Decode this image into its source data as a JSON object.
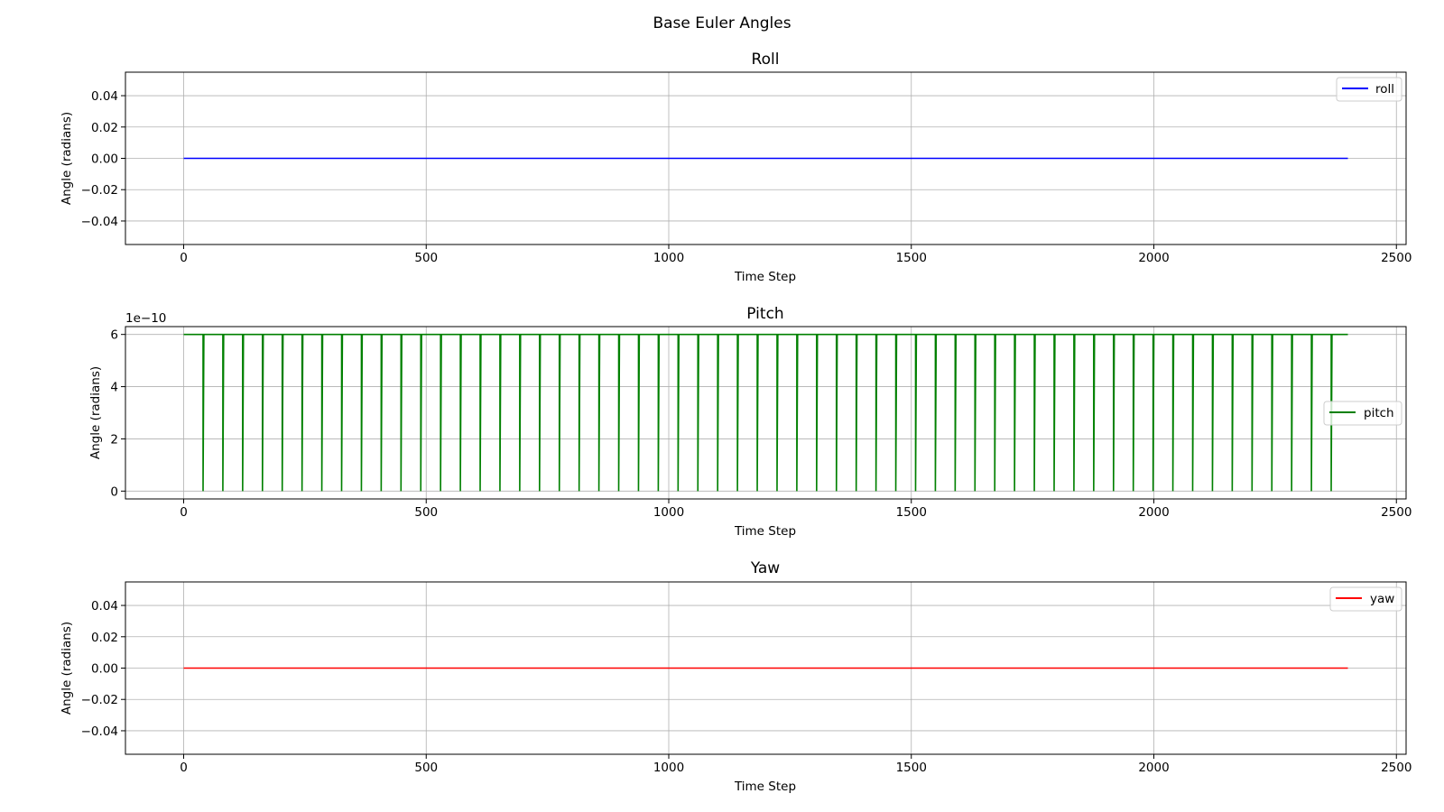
{
  "figure": {
    "title": "Base Euler Angles"
  },
  "chart_data": [
    {
      "type": "line",
      "title": "Roll",
      "xlabel": "Time Step",
      "ylabel": "Angle (radians)",
      "xlim": [
        -120,
        2520
      ],
      "ylim": [
        -0.055,
        0.055
      ],
      "xticks": [
        0,
        500,
        1000,
        1500,
        2000,
        2500
      ],
      "xtick_labels": [
        "0",
        "500",
        "1000",
        "1500",
        "2000",
        "2500"
      ],
      "yticks": [
        -0.04,
        -0.02,
        0.0,
        0.02,
        0.04
      ],
      "ytick_labels": [
        "−0.04",
        "−0.02",
        "0.00",
        "0.02",
        "0.04"
      ],
      "y_offset_label": "",
      "grid": true,
      "legend_position": "upper right",
      "series": [
        {
          "name": "roll",
          "color": "#0000ff",
          "kind": "constant",
          "x_range": [
            0,
            2400
          ],
          "value": 0.0
        }
      ]
    },
    {
      "type": "line",
      "title": "Pitch",
      "xlabel": "Time Step",
      "ylabel": "Angle (radians)",
      "xlim": [
        -120,
        2520
      ],
      "ylim": [
        -0.3,
        6.3
      ],
      "xticks": [
        0,
        500,
        1000,
        1500,
        2000,
        2500
      ],
      "xtick_labels": [
        "0",
        "500",
        "1000",
        "1500",
        "2000",
        "2500"
      ],
      "yticks": [
        0,
        2,
        4,
        6
      ],
      "ytick_labels": [
        "0",
        "2",
        "4",
        "6"
      ],
      "y_offset_label": "1e−10",
      "grid": true,
      "legend_position": "center right",
      "series": [
        {
          "name": "pitch",
          "color": "#008000",
          "kind": "periodic_drops",
          "x_range": [
            0,
            2400
          ],
          "high": 6,
          "low": 0,
          "first_drop": 40,
          "period": 40.8,
          "count": 58
        }
      ]
    },
    {
      "type": "line",
      "title": "Yaw",
      "xlabel": "Time Step",
      "ylabel": "Angle (radians)",
      "xlim": [
        -120,
        2520
      ],
      "ylim": [
        -0.055,
        0.055
      ],
      "xticks": [
        0,
        500,
        1000,
        1500,
        2000,
        2500
      ],
      "xtick_labels": [
        "0",
        "500",
        "1000",
        "1500",
        "2000",
        "2500"
      ],
      "yticks": [
        -0.04,
        -0.02,
        0.0,
        0.02,
        0.04
      ],
      "ytick_labels": [
        "−0.04",
        "−0.02",
        "0.00",
        "0.02",
        "0.04"
      ],
      "y_offset_label": "",
      "grid": true,
      "legend_position": "upper right",
      "series": [
        {
          "name": "yaw",
          "color": "#ff0000",
          "kind": "constant",
          "x_range": [
            0,
            2400
          ],
          "value": 0.0
        }
      ]
    }
  ]
}
